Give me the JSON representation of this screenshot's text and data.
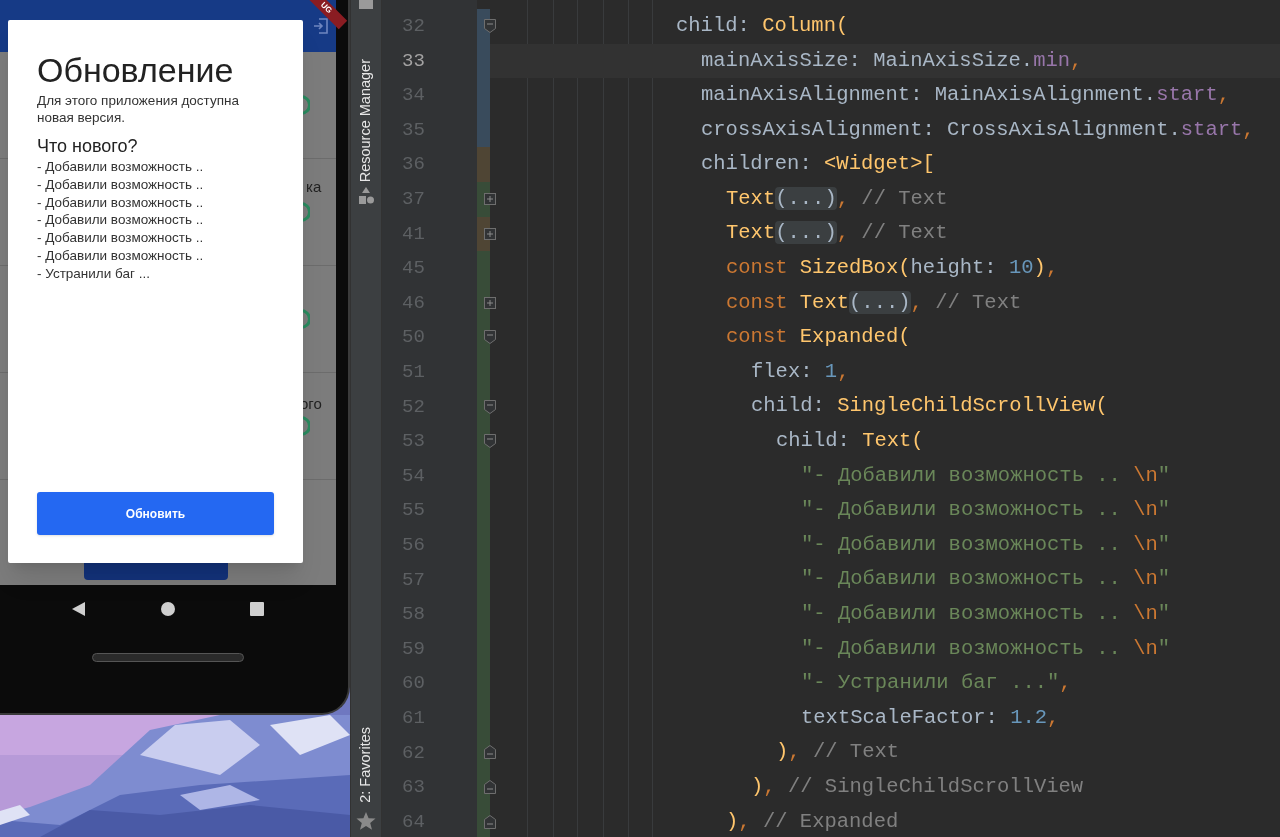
{
  "phone": {
    "debug_banner": "UG",
    "background_fragments": [
      {
        "text": "ка"
      },
      {
        "text": "ого"
      }
    ],
    "dialog": {
      "title": "Обновление",
      "message": "Для этого приложения доступна новая версия.",
      "whats_new_title": "Что нового?",
      "changes": [
        "- Добавили возможность ..",
        "- Добавили возможность ..",
        "- Добавили возможность ..",
        "- Добавили возможность ..",
        "- Добавили возможность ..",
        "- Добавили возможность ..",
        "- Устранили баг ..."
      ],
      "button": "Обновить"
    }
  },
  "ide": {
    "tool_windows": [
      {
        "label": "Resource Manager"
      },
      {
        "label": "2: Favorites"
      }
    ],
    "lines": [
      {
        "number": "32",
        "current": false,
        "color": "#394b5c",
        "kind": "opener",
        "tokens": [
          {
            "kind": "plain",
            "text": "child: "
          },
          {
            "kind": "call",
            "text": "Column("
          }
        ],
        "children": [
          {
            "number": "33",
            "current": true,
            "color": "#394b5c",
            "tokens": [
              {
                "kind": "plain",
                "text": "mainAxisSize: MainAxisSize."
              },
              {
                "kind": "const",
                "text": "min"
              },
              {
                "kind": "comma",
                "text": ","
              }
            ]
          },
          {
            "number": "34",
            "current": false,
            "color": "#394b5c",
            "tokens": [
              {
                "kind": "plain",
                "text": "mainAxisAlignment: MainAxisAlignment."
              },
              {
                "kind": "const",
                "text": "start"
              },
              {
                "kind": "comma",
                "text": ","
              }
            ]
          },
          {
            "number": "35",
            "current": false,
            "color": "#394b5c",
            "tokens": [
              {
                "kind": "plain",
                "text": "crossAxisAlignment: CrossAxisAlignment."
              },
              {
                "kind": "const",
                "text": "start"
              },
              {
                "kind": "comma",
                "text": ","
              }
            ]
          },
          {
            "number": "36",
            "current": false,
            "color": "#4f4534",
            "tokens": [
              {
                "kind": "plain",
                "text": "children: "
              },
              {
                "kind": "call",
                "text": "<Widget>["
              }
            ],
            "children": [
              {
                "number": "37",
                "current": false,
                "color": "#384c38",
                "kind": "folded",
                "tokens": [
                  {
                    "kind": "call",
                    "text": "Text"
                  },
                  {
                    "kind": "fold",
                    "text": "(...)"
                  },
                  {
                    "kind": "comma",
                    "text": ", "
                  },
                  {
                    "kind": "comment",
                    "text": "// Text"
                  }
                ]
              },
              {
                "number": "41",
                "current": false,
                "color": "#4f4534",
                "kind": "folded",
                "tokens": [
                  {
                    "kind": "call",
                    "text": "Text"
                  },
                  {
                    "kind": "fold",
                    "text": "(...)"
                  },
                  {
                    "kind": "comma",
                    "text": ", "
                  },
                  {
                    "kind": "comment",
                    "text": "// Text"
                  }
                ]
              },
              {
                "number": "45",
                "current": false,
                "color": "#384c38",
                "tokens": [
                  {
                    "kind": "keyword",
                    "text": "const "
                  },
                  {
                    "kind": "call",
                    "text": "SizedBox("
                  },
                  {
                    "kind": "plain",
                    "text": "height: "
                  },
                  {
                    "kind": "number",
                    "text": "10"
                  },
                  {
                    "kind": "call",
                    "text": ")"
                  },
                  {
                    "kind": "comma",
                    "text": ","
                  }
                ]
              },
              {
                "number": "46",
                "current": false,
                "color": "#384c38",
                "kind": "folded",
                "tokens": [
                  {
                    "kind": "keyword",
                    "text": "const "
                  },
                  {
                    "kind": "call",
                    "text": "Text"
                  },
                  {
                    "kind": "fold",
                    "text": "(...)"
                  },
                  {
                    "kind": "comma",
                    "text": ", "
                  },
                  {
                    "kind": "comment",
                    "text": "// Text"
                  }
                ]
              },
              {
                "number": "50",
                "current": false,
                "color": "#384c38",
                "kind": "opener",
                "tokens": [
                  {
                    "kind": "keyword",
                    "text": "const "
                  },
                  {
                    "kind": "call",
                    "text": "Expanded("
                  }
                ],
                "children": [
                  {
                    "number": "51",
                    "current": false,
                    "color": "#384c38",
                    "tokens": [
                      {
                        "kind": "plain",
                        "text": "flex: "
                      },
                      {
                        "kind": "number",
                        "text": "1"
                      },
                      {
                        "kind": "comma",
                        "text": ","
                      }
                    ]
                  },
                  {
                    "number": "52",
                    "current": false,
                    "color": "#384c38",
                    "kind": "opener",
                    "tokens": [
                      {
                        "kind": "plain",
                        "text": "child: "
                      },
                      {
                        "kind": "call",
                        "text": "SingleChildScrollView("
                      }
                    ],
                    "children": [
                      {
                        "number": "53",
                        "current": false,
                        "color": "#384c38",
                        "kind": "opener",
                        "tokens": [
                          {
                            "kind": "plain",
                            "text": "child: "
                          },
                          {
                            "kind": "call",
                            "text": "Text("
                          }
                        ],
                        "children": [
                          {
                            "number": "54",
                            "current": false,
                            "color": "#384c38",
                            "tokens": [
                              {
                                "kind": "string",
                                "text": "\"- Добавили возможность .. "
                              },
                              {
                                "kind": "escape",
                                "text": "\\n"
                              },
                              {
                                "kind": "string",
                                "text": "\""
                              }
                            ]
                          },
                          {
                            "number": "55",
                            "current": false,
                            "color": "#384c38",
                            "tokens": [
                              {
                                "kind": "string",
                                "text": "\"- Добавили возможность .. "
                              },
                              {
                                "kind": "escape",
                                "text": "\\n"
                              },
                              {
                                "kind": "string",
                                "text": "\""
                              }
                            ]
                          },
                          {
                            "number": "56",
                            "current": false,
                            "color": "#384c38",
                            "tokens": [
                              {
                                "kind": "string",
                                "text": "\"- Добавили возможность .. "
                              },
                              {
                                "kind": "escape",
                                "text": "\\n"
                              },
                              {
                                "kind": "string",
                                "text": "\""
                              }
                            ]
                          },
                          {
                            "number": "57",
                            "current": false,
                            "color": "#384c38",
                            "tokens": [
                              {
                                "kind": "string",
                                "text": "\"- Добавили возможность .. "
                              },
                              {
                                "kind": "escape",
                                "text": "\\n"
                              },
                              {
                                "kind": "string",
                                "text": "\""
                              }
                            ]
                          },
                          {
                            "number": "58",
                            "current": false,
                            "color": "#384c38",
                            "tokens": [
                              {
                                "kind": "string",
                                "text": "\"- Добавили возможность .. "
                              },
                              {
                                "kind": "escape",
                                "text": "\\n"
                              },
                              {
                                "kind": "string",
                                "text": "\""
                              }
                            ]
                          },
                          {
                            "number": "59",
                            "current": false,
                            "color": "#384c38",
                            "tokens": [
                              {
                                "kind": "string",
                                "text": "\"- Добавили возможность .. "
                              },
                              {
                                "kind": "escape",
                                "text": "\\n"
                              },
                              {
                                "kind": "string",
                                "text": "\""
                              }
                            ]
                          },
                          {
                            "number": "60",
                            "current": false,
                            "color": "#384c38",
                            "tokens": [
                              {
                                "kind": "string",
                                "text": "\"- Устранили баг ...\""
                              },
                              {
                                "kind": "comma",
                                "text": ","
                              }
                            ]
                          },
                          {
                            "number": "61",
                            "current": false,
                            "color": "#384c38",
                            "tokens": [
                              {
                                "kind": "plain",
                                "text": "textScaleFactor: "
                              },
                              {
                                "kind": "number",
                                "text": "1.2"
                              },
                              {
                                "kind": "comma",
                                "text": ","
                              }
                            ]
                          }
                        ]
                      },
                      {
                        "number": "62",
                        "current": false,
                        "color": "#384c38",
                        "kind": "closer",
                        "tokens": [
                          {
                            "kind": "call",
                            "text": ")"
                          },
                          {
                            "kind": "comma",
                            "text": ", "
                          },
                          {
                            "kind": "comment",
                            "text": "// Text"
                          }
                        ]
                      }
                    ]
                  },
                  {
                    "number": "63",
                    "current": false,
                    "color": "#384c38",
                    "kind": "closer",
                    "tokens": [
                      {
                        "kind": "call",
                        "text": ")"
                      },
                      {
                        "kind": "comma",
                        "text": ", "
                      },
                      {
                        "kind": "comment",
                        "text": "// SingleChildScrollView"
                      }
                    ]
                  }
                ]
              },
              {
                "number": "64",
                "current": false,
                "color": "#384c38",
                "kind": "closer",
                "tokens": [
                  {
                    "kind": "call",
                    "text": ")"
                  },
                  {
                    "kind": "comma",
                    "text": ", "
                  },
                  {
                    "kind": "comment",
                    "text": "// Expanded"
                  }
                ]
              }
            ]
          }
        ]
      }
    ]
  }
}
